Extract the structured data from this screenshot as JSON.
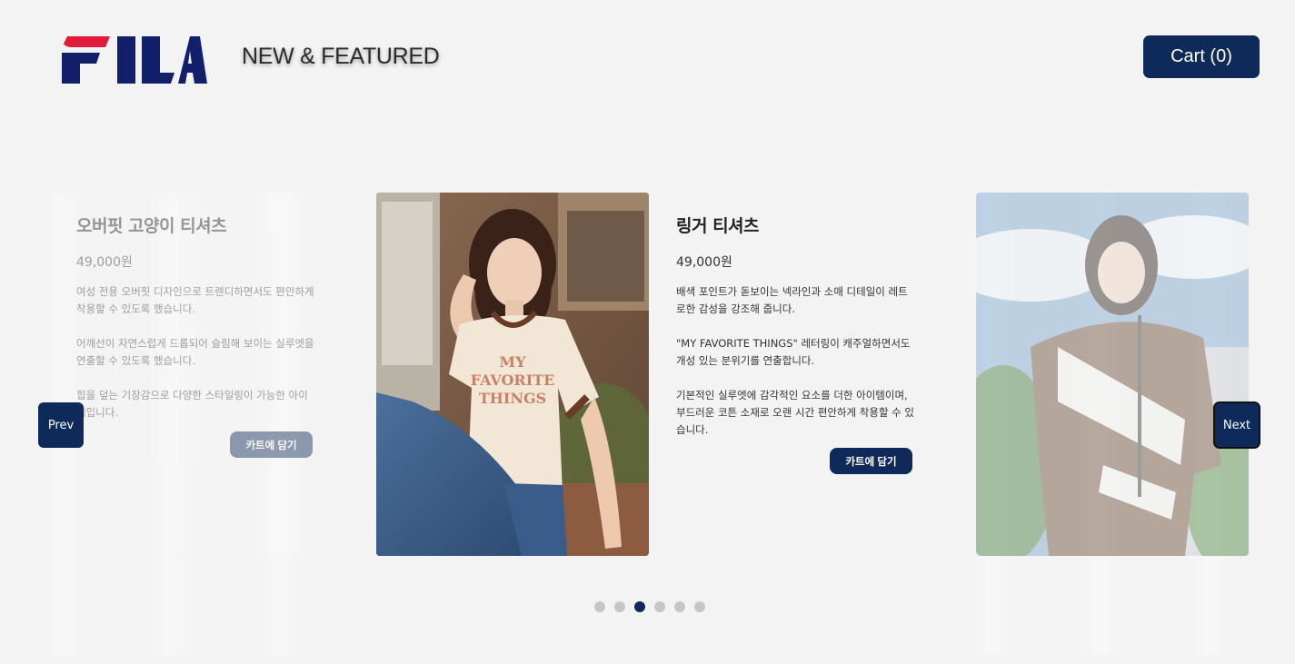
{
  "header": {
    "logo_text": "FILA",
    "section_title": "NEW & FEATURED",
    "cart_label": "Cart (0)"
  },
  "slides": [
    {
      "name": "오버핏 고양이 티셔츠",
      "price": "49,000원",
      "desc": [
        "여성 전용 오버핏 디자인으로 트렌디하면서도 편안하게 착용할 수 있도록 했습니다.",
        "어깨선이 자연스럽게 드롭되어 슬림해 보이는 실루엣을 연출할 수 있도록 했습니다.",
        "힙을 덮는 기장감으로 다양한 스타일링이 가능한 아이템입니다."
      ],
      "button": "카트에 담기"
    },
    {
      "name": "링거 티셔츠",
      "price": "49,000원",
      "desc": [
        "배색 포인트가 돋보이는 넥라인과 소매 디테일이 레트로한 감성을 강조해 줍니다.",
        "\"MY FAVORITE THINGS\" 레터링이 캐주얼하면서도 개성 있는 분위기를 연출합니다.",
        "기본적인 실루엣에 감각적인 요소를 더한 아이템이며, 부드러운 코튼 소재로 오랜 시간 편안하게 착용할 수 있습니다."
      ],
      "button": "카트에 담기",
      "shirt_print": "MY FAVORITE THINGS"
    }
  ],
  "nav": {
    "prev": "Prev",
    "next": "Next"
  },
  "pagination": {
    "total": 6,
    "active_index": 2
  },
  "colors": {
    "brand_navy": "#0e2a5a",
    "fila_red": "#e31b3b",
    "fila_navy": "#12206b",
    "background": "#f3f3f3"
  }
}
